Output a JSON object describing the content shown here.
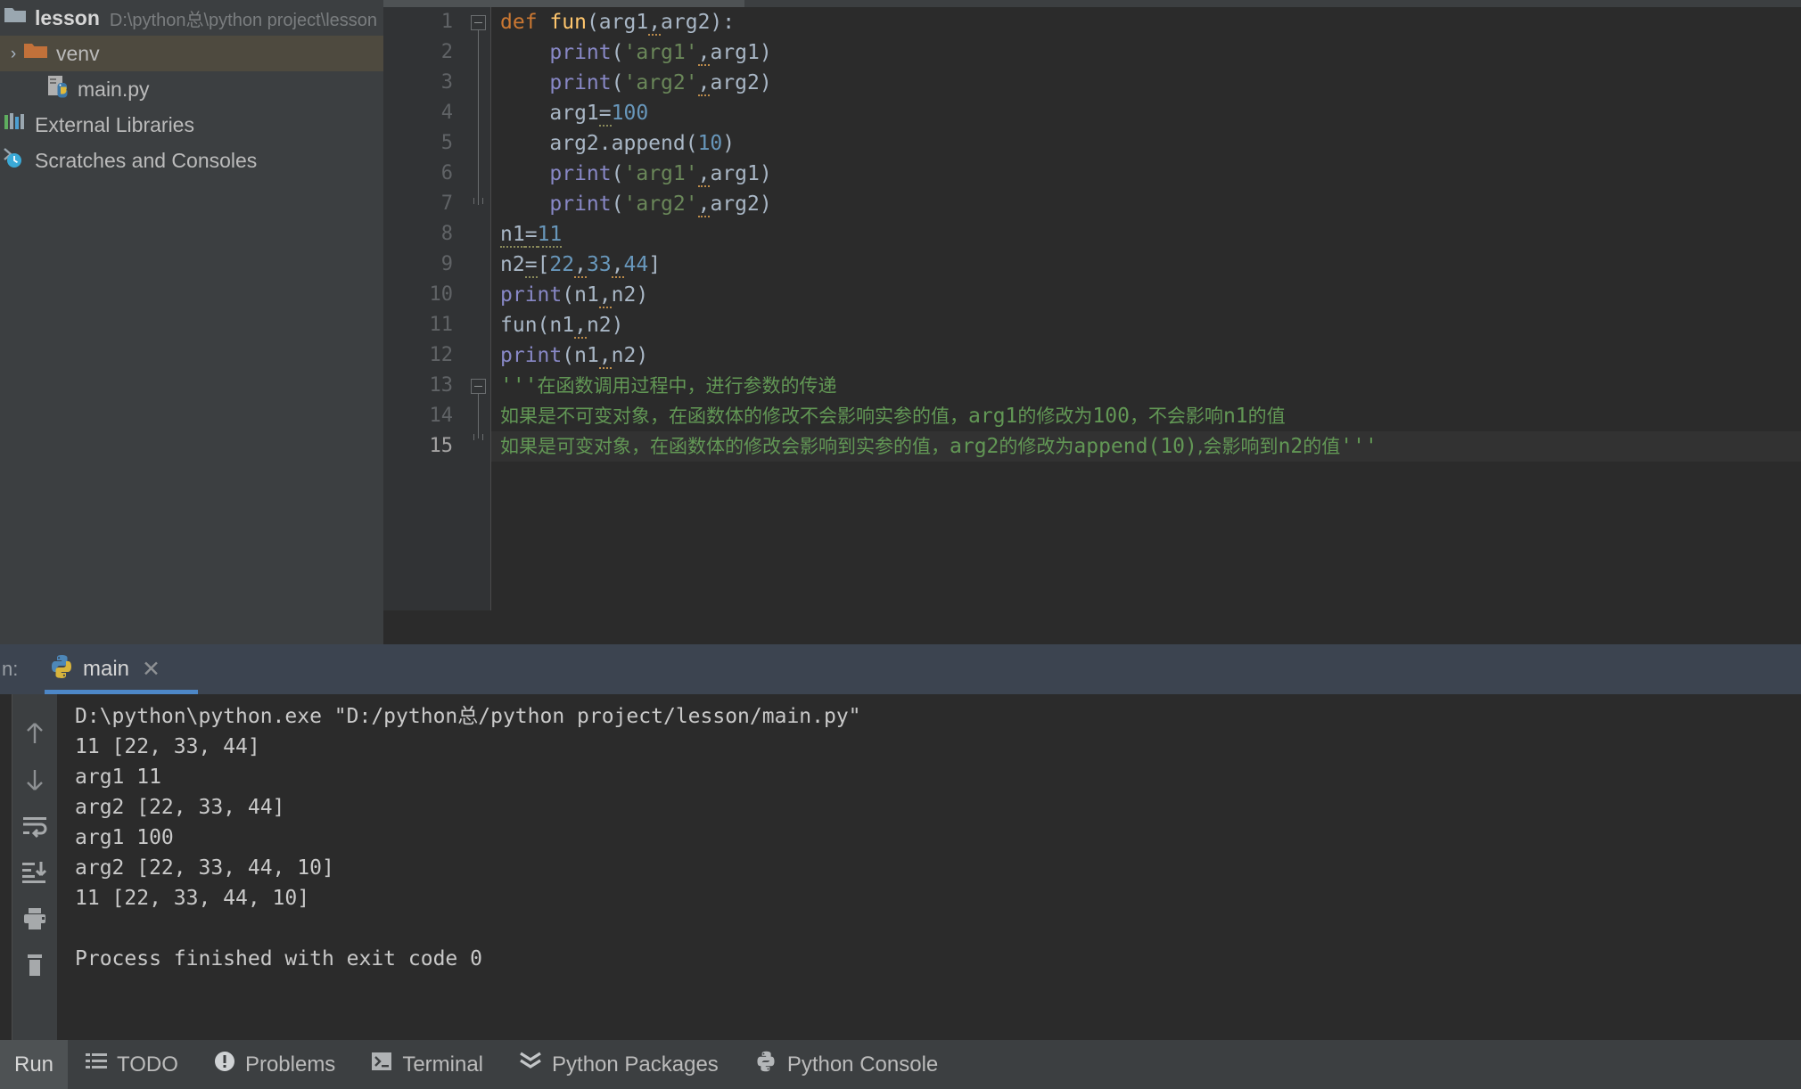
{
  "sidebar": {
    "project_root": {
      "name": "lesson",
      "path": "D:\\python总\\python project\\lesson",
      "icon": "folder-icon"
    },
    "items": [
      {
        "label": "venv",
        "icon": "folder-orange-icon",
        "selected": true,
        "arrow": "›"
      },
      {
        "label": "main.py",
        "icon": "python-file-icon",
        "selected": false
      },
      {
        "label": "External Libraries",
        "icon": "libraries-icon",
        "selected": false
      },
      {
        "label": "Scratches and Consoles",
        "icon": "scratches-icon",
        "selected": false
      }
    ]
  },
  "editor": {
    "lines": [
      {
        "n": "1",
        "segments": [
          {
            "t": "def ",
            "c": "kw"
          },
          {
            "t": "fun",
            "c": "fn"
          },
          {
            "t": "(arg1",
            "c": "pln"
          },
          {
            "t": ",",
            "c": "wavy-o pln"
          },
          {
            "t": "arg2):",
            "c": "pln"
          }
        ],
        "indent": 0
      },
      {
        "n": "2",
        "segments": [
          {
            "t": "    ",
            "c": "pln"
          },
          {
            "t": "print",
            "c": "fnc"
          },
          {
            "t": "(",
            "c": "pln"
          },
          {
            "t": "'arg1'",
            "c": "str"
          },
          {
            "t": ",",
            "c": "wavy-o pln"
          },
          {
            "t": "arg1)",
            "c": "pln"
          }
        ],
        "indent": 0
      },
      {
        "n": "3",
        "segments": [
          {
            "t": "    ",
            "c": "pln"
          },
          {
            "t": "print",
            "c": "fnc"
          },
          {
            "t": "(",
            "c": "pln"
          },
          {
            "t": "'arg2'",
            "c": "str"
          },
          {
            "t": ",",
            "c": "wavy-o pln"
          },
          {
            "t": "arg2)",
            "c": "pln"
          }
        ],
        "indent": 0
      },
      {
        "n": "4",
        "segments": [
          {
            "t": "    arg1",
            "c": "pln"
          },
          {
            "t": "=",
            "c": "wavy-g pln"
          },
          {
            "t": "100",
            "c": "num"
          }
        ],
        "indent": 0
      },
      {
        "n": "5",
        "segments": [
          {
            "t": "    arg2.append(",
            "c": "pln"
          },
          {
            "t": "10",
            "c": "num"
          },
          {
            "t": ")",
            "c": "pln"
          }
        ],
        "indent": 0
      },
      {
        "n": "6",
        "segments": [
          {
            "t": "    ",
            "c": "pln"
          },
          {
            "t": "print",
            "c": "fnc"
          },
          {
            "t": "(",
            "c": "pln"
          },
          {
            "t": "'arg1'",
            "c": "str"
          },
          {
            "t": ",",
            "c": "wavy-o pln"
          },
          {
            "t": "arg1)",
            "c": "pln"
          }
        ],
        "indent": 0
      },
      {
        "n": "7",
        "segments": [
          {
            "t": "    ",
            "c": "pln"
          },
          {
            "t": "print",
            "c": "fnc"
          },
          {
            "t": "(",
            "c": "pln"
          },
          {
            "t": "'arg2'",
            "c": "str"
          },
          {
            "t": ",",
            "c": "wavy-o pln"
          },
          {
            "t": "arg2)",
            "c": "pln"
          }
        ],
        "indent": 0
      },
      {
        "n": "8",
        "segments": [
          {
            "t": "n1",
            "c": "wavy-g pln"
          },
          {
            "t": "=",
            "c": "wavy-g pln"
          },
          {
            "t": "11",
            "c": "wavy-g num"
          }
        ],
        "indent": 0
      },
      {
        "n": "9",
        "segments": [
          {
            "t": "n2",
            "c": "pln"
          },
          {
            "t": "=",
            "c": "wavy-g pln"
          },
          {
            "t": "[",
            "c": "pln"
          },
          {
            "t": "22",
            "c": "num"
          },
          {
            "t": ",",
            "c": "wavy-o pln"
          },
          {
            "t": "33",
            "c": "num"
          },
          {
            "t": ",",
            "c": "wavy-o pln"
          },
          {
            "t": "44",
            "c": "num"
          },
          {
            "t": "]",
            "c": "pln"
          }
        ],
        "indent": 0
      },
      {
        "n": "10",
        "segments": [
          {
            "t": "print",
            "c": "fnc"
          },
          {
            "t": "(n1",
            "c": "pln"
          },
          {
            "t": ",",
            "c": "wavy-o pln"
          },
          {
            "t": "n2)",
            "c": "pln"
          }
        ],
        "indent": 0
      },
      {
        "n": "11",
        "segments": [
          {
            "t": "fun(n1",
            "c": "pln"
          },
          {
            "t": ",",
            "c": "wavy-o pln"
          },
          {
            "t": "n2)",
            "c": "pln"
          }
        ],
        "indent": 0
      },
      {
        "n": "12",
        "segments": [
          {
            "t": "print",
            "c": "fnc"
          },
          {
            "t": "(n1",
            "c": "pln"
          },
          {
            "t": ",",
            "c": "wavy-o pln"
          },
          {
            "t": "n2)",
            "c": "pln"
          }
        ],
        "indent": 0
      },
      {
        "n": "13",
        "segments": [
          {
            "t": "'''",
            "c": "cmt"
          },
          {
            "t": "在函数调用过程中，进行参数的传递",
            "c": "cmt-zh"
          }
        ],
        "indent": 0
      },
      {
        "n": "14",
        "segments": [
          {
            "t": "如果是不可变对象，在函数体的修改不会影响实参的值，",
            "c": "cmt-zh"
          },
          {
            "t": "arg1",
            "c": "cmt"
          },
          {
            "t": "的修改为",
            "c": "cmt-zh"
          },
          {
            "t": "100",
            "c": "cmt"
          },
          {
            "t": "，不会影响",
            "c": "cmt-zh"
          },
          {
            "t": "n1",
            "c": "cmt"
          },
          {
            "t": "的值",
            "c": "cmt-zh"
          }
        ],
        "indent": 0
      },
      {
        "n": "15",
        "segments": [
          {
            "t": "如果是可变对象，在函数体的修改会影响到实参的值，",
            "c": "cmt-zh"
          },
          {
            "t": "arg2",
            "c": "cmt"
          },
          {
            "t": "的修改为",
            "c": "cmt-zh"
          },
          {
            "t": "append(10)",
            "c": "cmt"
          },
          {
            "t": ",会影响到",
            "c": "cmt-zh"
          },
          {
            "t": "n2",
            "c": "cmt"
          },
          {
            "t": "的值",
            "c": "cmt-zh"
          },
          {
            "t": "'''",
            "c": "cmt"
          }
        ],
        "indent": 0,
        "highlight": true
      }
    ]
  },
  "run_panel": {
    "header_prefix": "n:",
    "tab_label": "main",
    "tab_icon": "python-icon",
    "close_icon": "close-icon",
    "toolbar": [
      {
        "name": "up-arrow-icon",
        "title": "Up"
      },
      {
        "name": "down-arrow-icon",
        "title": "Down"
      },
      {
        "name": "soft-wrap-icon",
        "title": "Soft-Wrap"
      },
      {
        "name": "scroll-to-end-icon",
        "title": "Scroll to End"
      },
      {
        "name": "print-icon",
        "title": "Print"
      },
      {
        "name": "trash-icon",
        "title": "Clear All"
      }
    ],
    "output": [
      "D:\\python\\python.exe \"D:/python总/python project/lesson/main.py\"",
      "11 [22, 33, 44]",
      "arg1 11",
      "arg2 [22, 33, 44]",
      "arg1 100",
      "arg2 [22, 33, 44, 10]",
      "11 [22, 33, 44, 10]",
      "",
      "Process finished with exit code 0"
    ]
  },
  "statusbar": {
    "run_label": "Run",
    "items": [
      {
        "label": "TODO",
        "icon": "todo-list-icon"
      },
      {
        "label": "Problems",
        "icon": "problems-icon"
      },
      {
        "label": "Terminal",
        "icon": "terminal-icon"
      },
      {
        "label": "Python Packages",
        "icon": "packages-chevrons-icon"
      },
      {
        "label": "Python Console",
        "icon": "python-icon"
      }
    ]
  },
  "colors": {
    "editor_bg": "#2b2b2b",
    "panel_bg": "#3c3f41",
    "gutter_bg": "#313335",
    "selection": "#4e4a3f",
    "accent_blue": "#4d87c7",
    "run_header_bg": "#3c4450",
    "keyword": "#cc7832",
    "function": "#ffc66d",
    "string": "#6a8759",
    "number": "#6897bb",
    "comment": "#629755",
    "plain": "#a9b7c6"
  }
}
